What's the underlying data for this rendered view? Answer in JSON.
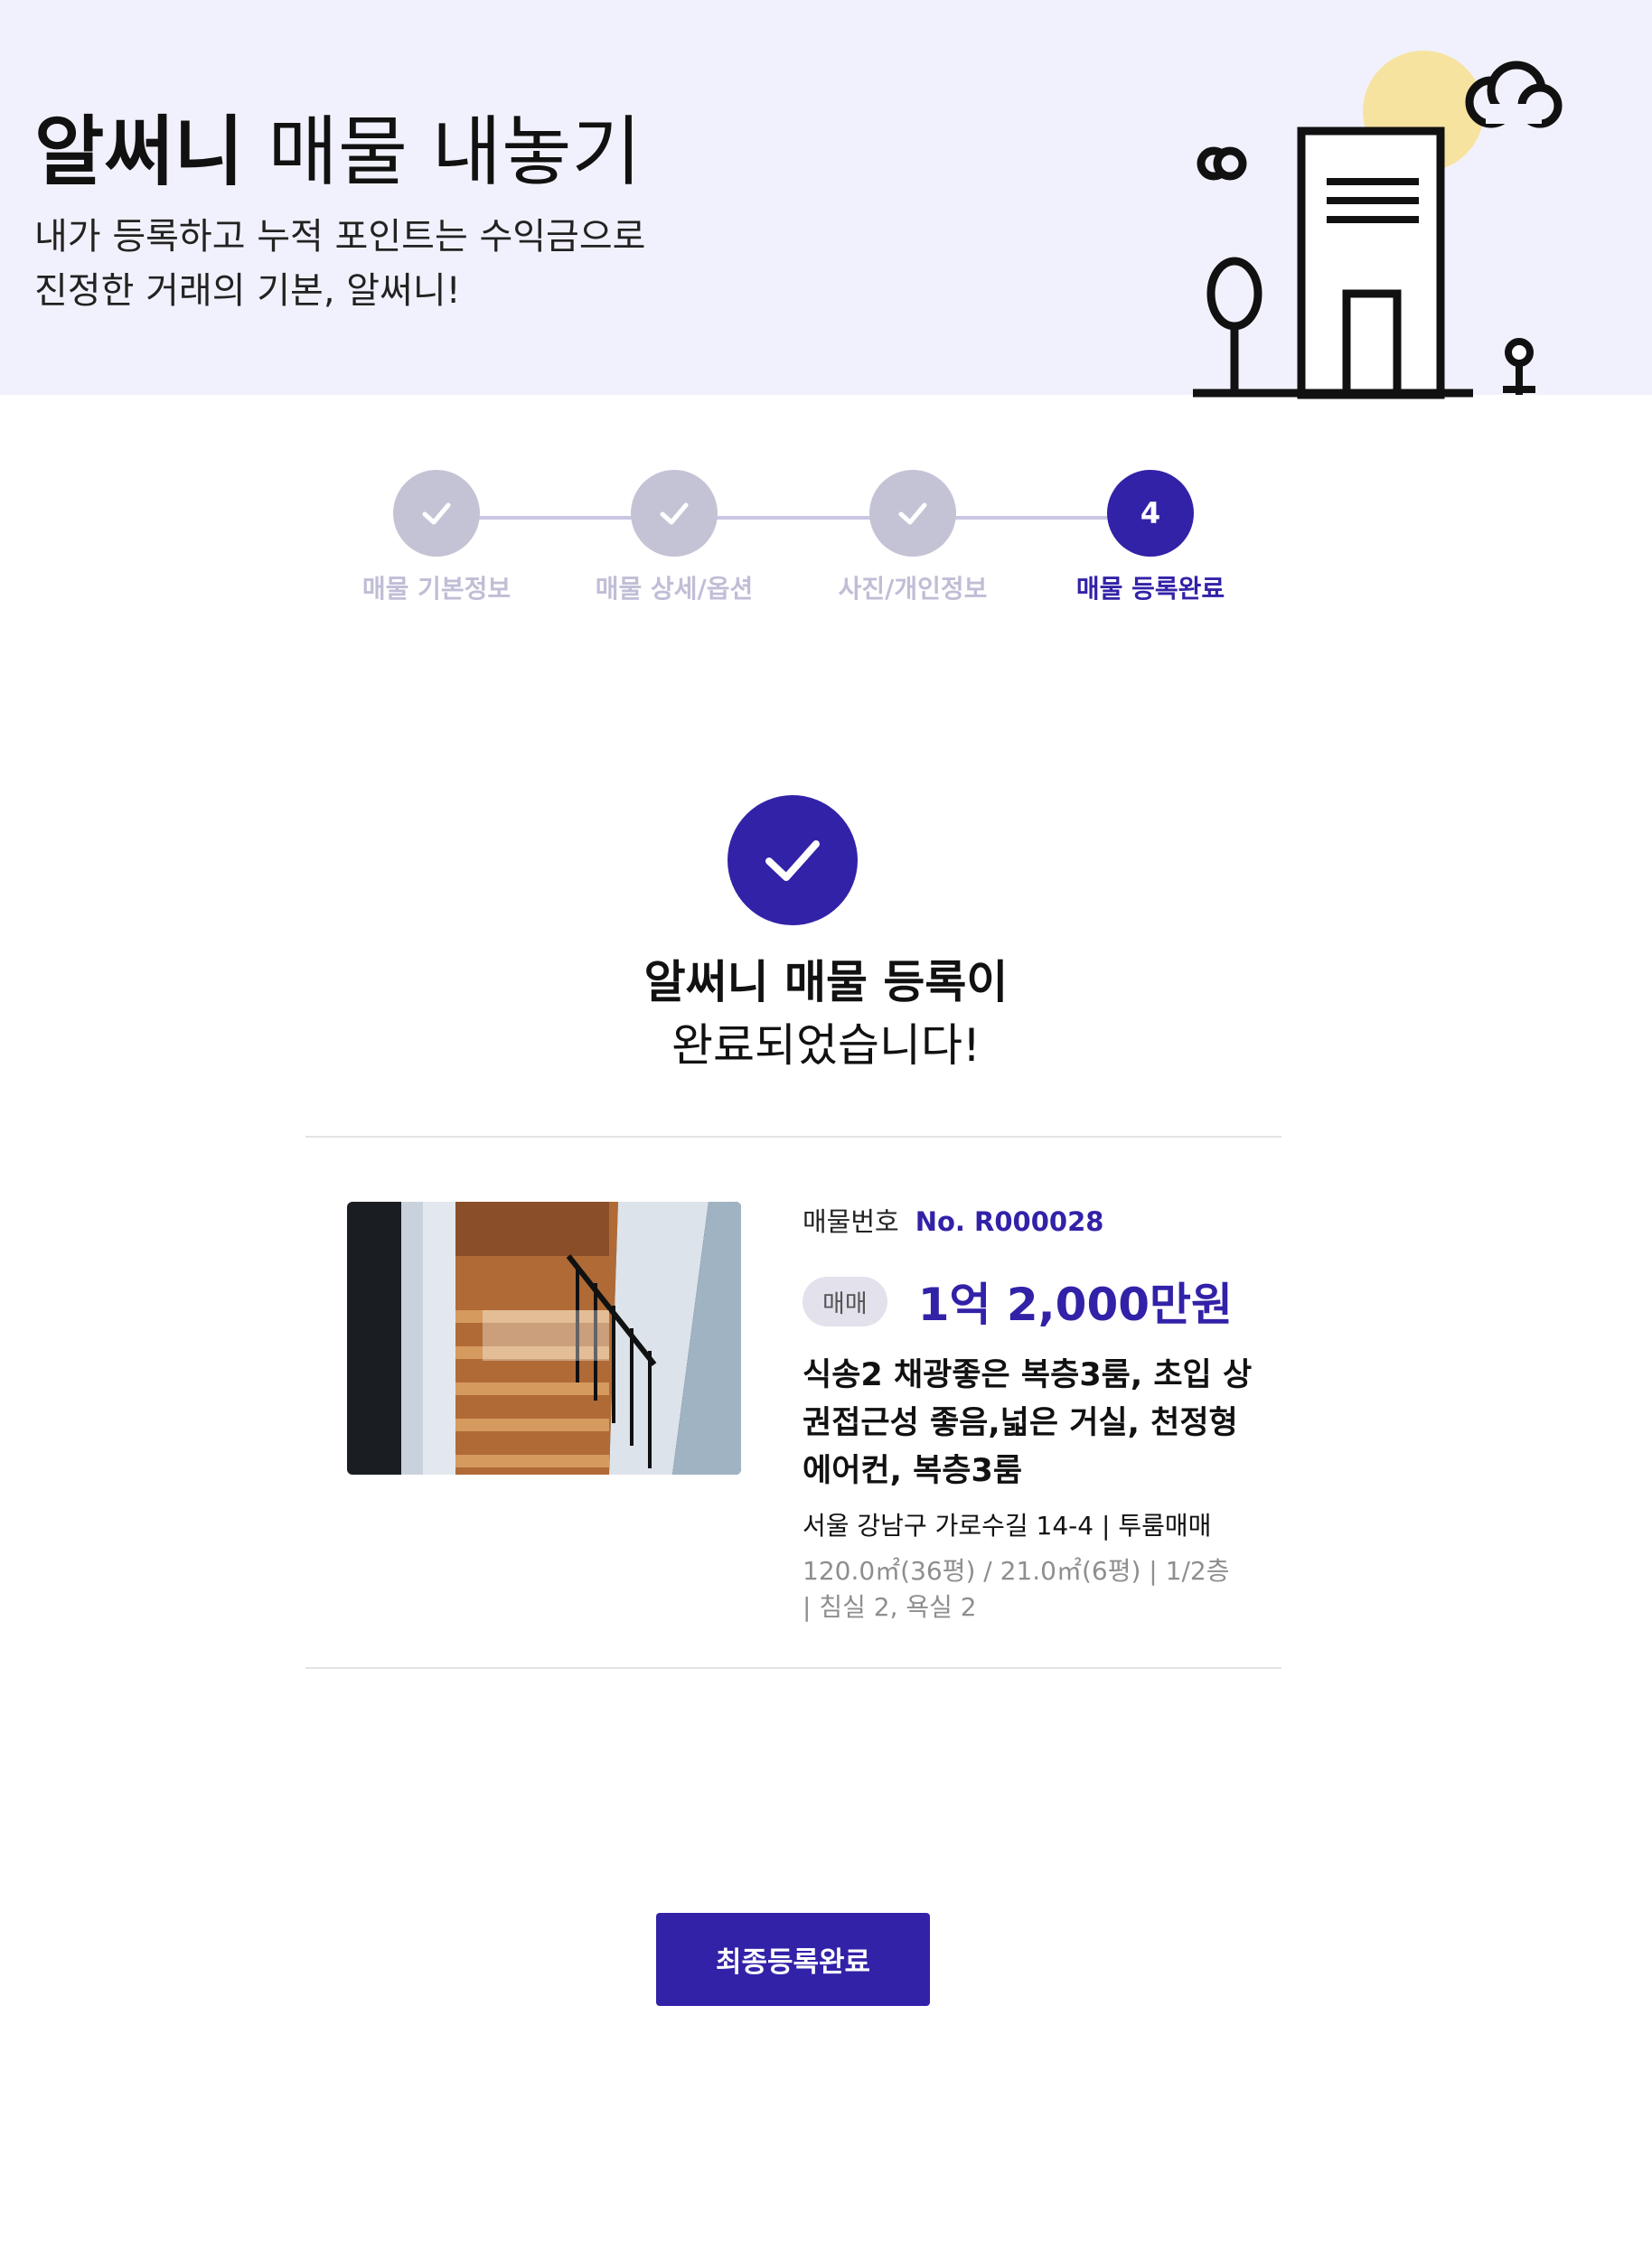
{
  "hero": {
    "brand": "알써니",
    "title_rest": " 매물 내놓기",
    "subtitle_line1": "내가 등록하고 누적 포인트는 수익금으로",
    "subtitle_line2": "진정한 거래의 기본, 알써니!"
  },
  "steps": [
    {
      "label": "매물 기본정보",
      "state": "done"
    },
    {
      "label": "매물 상세/옵션",
      "state": "done"
    },
    {
      "label": "사진/개인정보",
      "state": "done"
    },
    {
      "label": "매물 등록완료",
      "state": "active",
      "number": "4"
    }
  ],
  "completion": {
    "title": "알써니 매물 등록이",
    "subtitle": "완료되었습니다!"
  },
  "listing": {
    "number_label": "매물번호",
    "number_value": "No. R000028",
    "deal_type": "매매",
    "price": "1억 2,000만원",
    "title": "식송2 채광좋은 복층3룸, 초입 상권접근성 좋음,넓은 거실, 천정형 에어컨, 복층3룸",
    "address": "서울 강남구 가로수길 14-4 | 투룸매매",
    "spec_line1": "120.0㎡(36평) / 21.0㎡(6평) | 1/2층",
    "spec_line2": "| 침실 2, 욕실 2"
  },
  "final_button": "최종등록완료",
  "colors": {
    "accent": "#3222a8",
    "hero_bg": "#f1f1fd",
    "step_done": "#c4c3d6",
    "sun": "#f7e3a0"
  }
}
